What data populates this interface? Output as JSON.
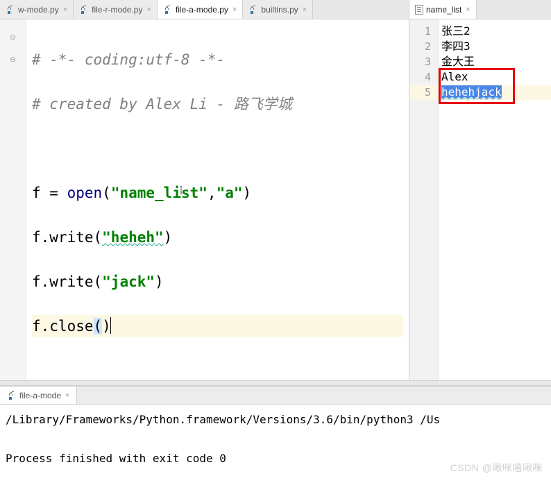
{
  "left_tabs": [
    {
      "label": "w-mode.py"
    },
    {
      "label": "file-r-mode.py"
    },
    {
      "label": "file-a-mode.py",
      "active": true
    },
    {
      "label": "builtins.py"
    }
  ],
  "right_tab": {
    "label": "name_list"
  },
  "code": {
    "l1": "# -*- coding:utf-8 -*-",
    "l2": "# created by Alex Li - 路飞学城",
    "l4_var": "f ",
    "l4_eq": "= ",
    "l4_open": "open",
    "l4_p1": "(",
    "l4_s1": "\"name_list\"",
    "l4_c": ",",
    "l4_s2": "\"a\"",
    "l4_p2": ")",
    "l5_a": "f.write(",
    "l5_s": "\"heheh\"",
    "l5_b": ")",
    "l6_a": "f.write(",
    "l6_s": "\"jack\"",
    "l6_b": ")",
    "l7_a": "f.close",
    "l7_p1": "(",
    "l7_p2": ")"
  },
  "right_lines": {
    "nums": [
      "1",
      "2",
      "3",
      "4",
      "5"
    ],
    "c1": "张三2",
    "c2": "李四3",
    "c3": "金大王",
    "c4": "Alex",
    "c5": "hehehjack"
  },
  "run": {
    "tab": "file-a-mode",
    "line1": "/Library/Frameworks/Python.framework/Versions/3.6/bin/python3 /Us",
    "line2": "Process finished with exit code 0"
  },
  "watermark": "CSDN @啾咪嘻啾咪"
}
